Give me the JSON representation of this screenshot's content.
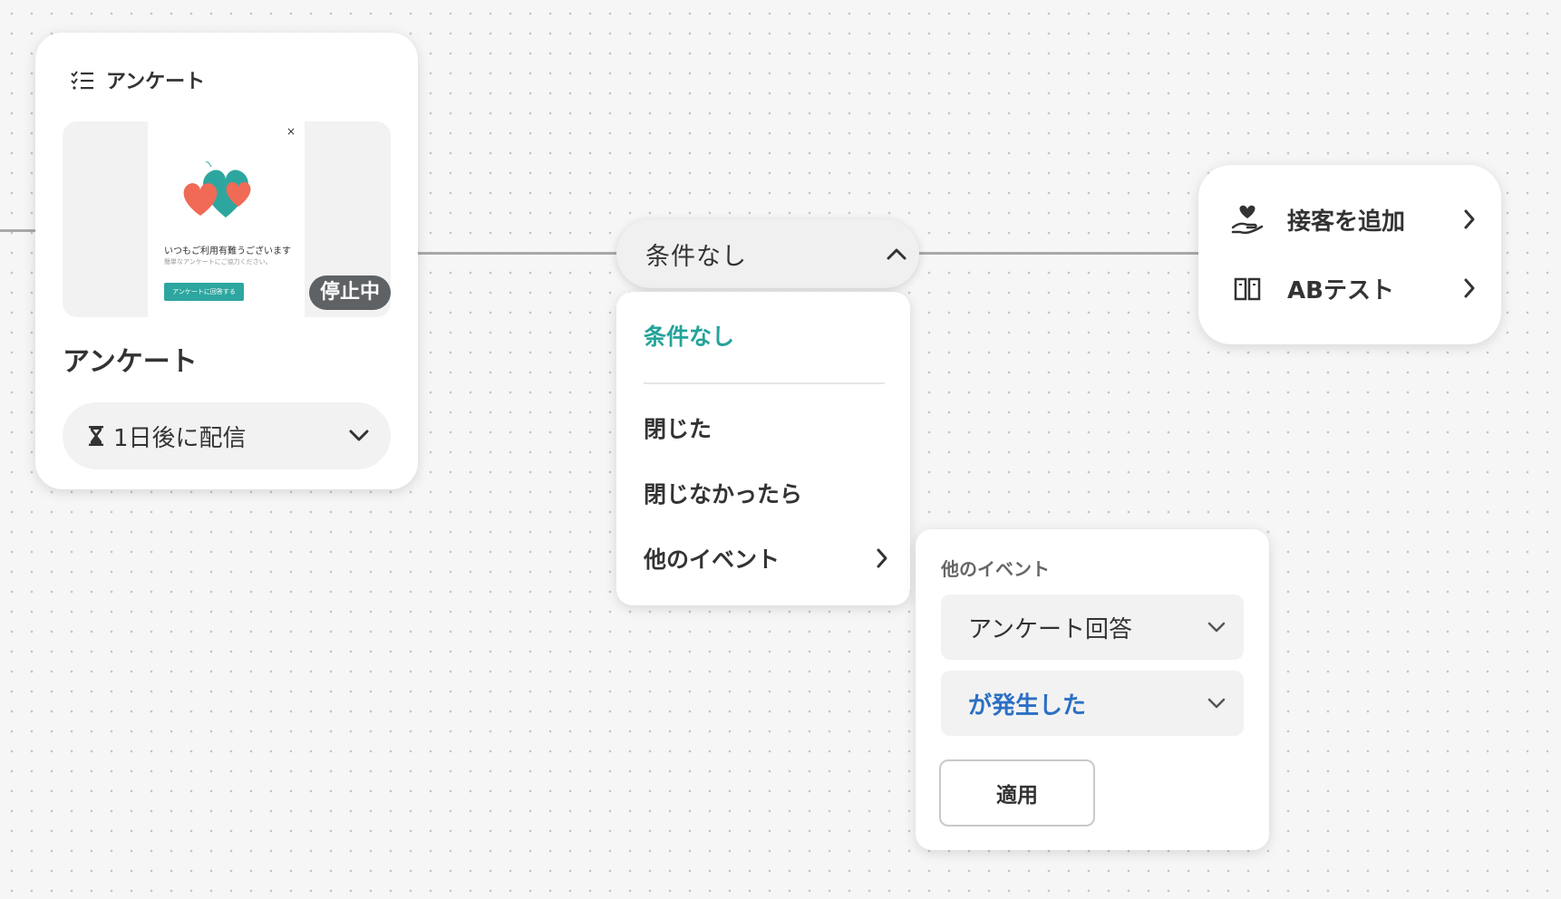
{
  "campaign": {
    "type_label": "アンケート",
    "title": "アンケート",
    "status": "停止中",
    "delivery": "1日後に配信",
    "preview": {
      "close": "×",
      "heading": "いつもご利用有難うございます",
      "subtext": "簡単なアンケートにご協力ください。",
      "button": "アンケートに回答する"
    }
  },
  "condition": {
    "selected": "条件なし",
    "menu": [
      "条件なし",
      "閉じた",
      "閉じなかったら",
      "他のイベント"
    ]
  },
  "event_panel": {
    "title": "他のイベント",
    "event": "アンケート回答",
    "trigger": "が発生した",
    "apply": "適用"
  },
  "actions": [
    {
      "label": "接客を追加",
      "icon": "hand-heart-icon"
    },
    {
      "label": "ABテスト",
      "icon": "book-icon"
    }
  ],
  "colors": {
    "accent_teal": "#24a39a",
    "accent_blue": "#2b6fc4",
    "status_badge": "#5e6264",
    "heart_red": "#f06a55",
    "heart_teal": "#2ea6a0"
  }
}
